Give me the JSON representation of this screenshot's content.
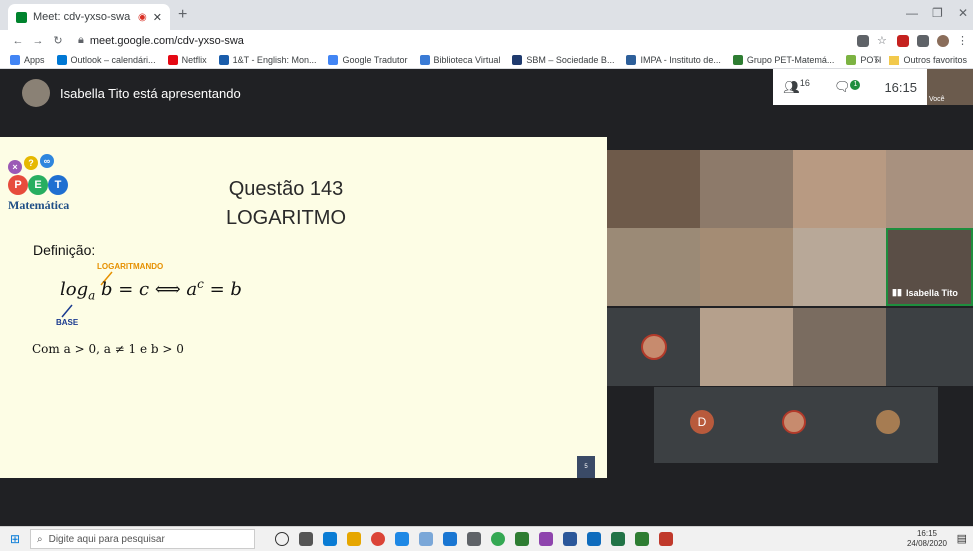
{
  "browser": {
    "tab_title": "Meet: cdv-yxso-swa",
    "new_tab": "+",
    "url": "meet.google.com/cdv-yxso-swa",
    "bookmarks": [
      {
        "label": "Apps",
        "color": "#4285f4"
      },
      {
        "label": "Outlook – calendári...",
        "color": "#0078d4"
      },
      {
        "label": "Netflix",
        "color": "#e50914"
      },
      {
        "label": "1&T - English: Mon...",
        "color": "#1a5dab"
      },
      {
        "label": "Google Tradutor",
        "color": "#4285f4"
      },
      {
        "label": "Biblioteca Virtual",
        "color": "#3a7bd5"
      },
      {
        "label": "SBM – Sociedade B...",
        "color": "#1f3a6e"
      },
      {
        "label": "IMPA - Instituto de...",
        "color": "#2d5f9a"
      },
      {
        "label": "Grupo PET-Matemá...",
        "color": "#2e7d32"
      },
      {
        "label": "POTI",
        "color": "#7cb342"
      }
    ],
    "bookmarks_more": "»",
    "other_bookmarks": "Outros favoritos"
  },
  "meet": {
    "presenter_text": "Isabella Tito está apresentando",
    "participants_icon": "people-icon",
    "participants_count": "16",
    "chat_badge": "1",
    "time": "16:15",
    "self_label": "Você",
    "slide": {
      "logo_letters": [
        "P",
        "E",
        "T"
      ],
      "logo_text": "Matemática",
      "title_line1": "Questão 143",
      "title_line2": "LOGARITMO",
      "definition_label": "Definição:",
      "logaritmando_label": "LOGARITMANDO",
      "base_label": "BASE",
      "formula_log": "log",
      "formula_base": "a",
      "formula_rest": " b = c ⟺ a",
      "formula_exp": "c",
      "formula_end": " = b",
      "condition": "Com a > 0, a ≠ 1 e b > 0",
      "page_number": "5"
    },
    "tile_label": "Isabella Tito",
    "bottom_letter": "D"
  },
  "taskbar": {
    "search_placeholder": "Digite aqui para pesquisar",
    "clock_time": "16:15",
    "clock_date": "24/08/2020"
  },
  "colors": {
    "slide_bg": "#fdfde5",
    "meet_bg": "#202124",
    "accent_orange": "#e69000",
    "accent_blue": "#1a3a8f"
  }
}
